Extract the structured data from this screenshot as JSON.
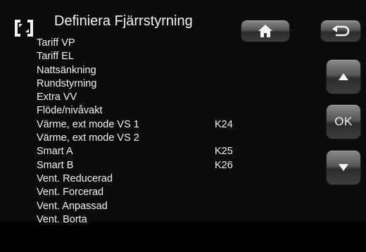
{
  "header": {
    "title": "Definiera Fjärrstyrning"
  },
  "buttons": {
    "ok_label": "OK"
  },
  "icons": {
    "title": "fullscreen-brackets-icon",
    "home": "home-icon",
    "back": "back-arrow-icon",
    "up": "arrow-up-icon",
    "down": "arrow-down-icon"
  },
  "list": {
    "items": [
      {
        "label": "Tariff VP",
        "value": ""
      },
      {
        "label": "Tariff EL",
        "value": ""
      },
      {
        "label": "Nattsänkning",
        "value": ""
      },
      {
        "label": "Rundstyrning",
        "value": ""
      },
      {
        "label": "Extra VV",
        "value": ""
      },
      {
        "label": "Flöde/nivåvakt",
        "value": ""
      },
      {
        "label": "Värme, ext mode VS 1",
        "value": "K24"
      },
      {
        "label": "Värme, ext mode VS 2",
        "value": ""
      },
      {
        "label": "Smart A",
        "value": "K25"
      },
      {
        "label": "Smart B",
        "value": "K26"
      },
      {
        "label": "Vent. Reducerad",
        "value": ""
      },
      {
        "label": "Vent. Forcerad",
        "value": ""
      },
      {
        "label": "Vent. Anpassad",
        "value": ""
      },
      {
        "label": "Vent. Borta",
        "value": ""
      }
    ]
  },
  "colors": {
    "background": "#0b0b0b",
    "text": "#f2f2f2",
    "button_gradient_top": "#8a8a8a",
    "button_gradient_bottom": "#2c2c2c"
  }
}
